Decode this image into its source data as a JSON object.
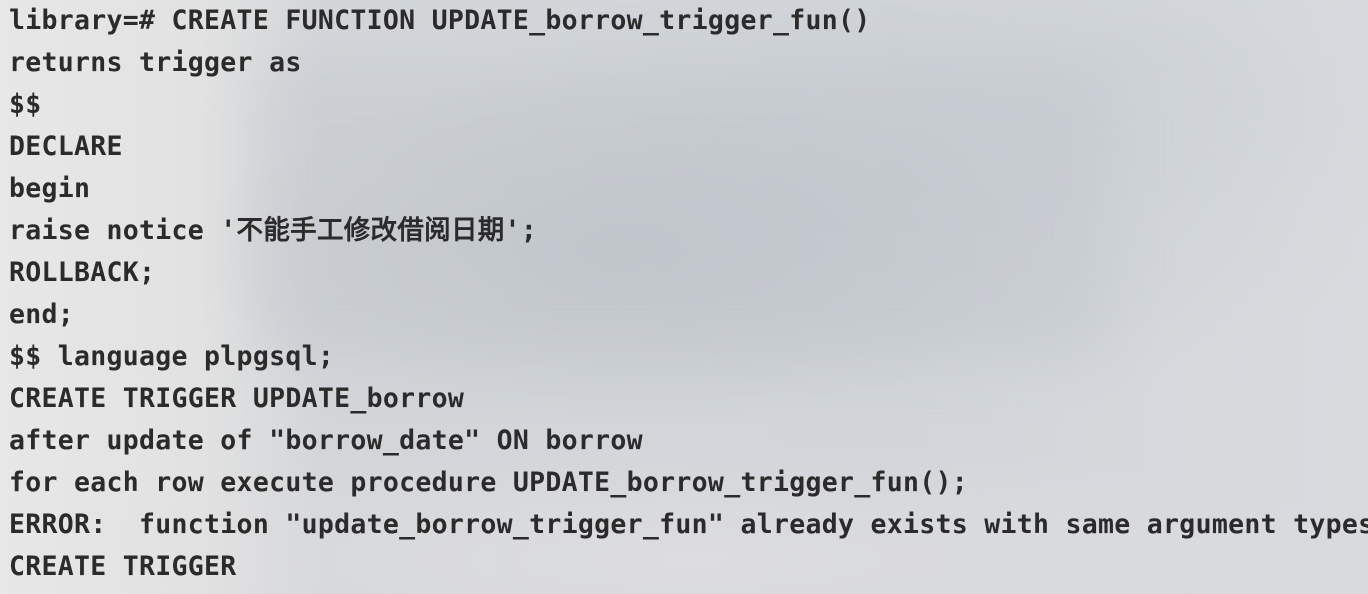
{
  "terminal": {
    "lines": [
      "library=# CREATE FUNCTION UPDATE_borrow_trigger_fun()",
      "returns trigger as",
      "$$",
      "DECLARE",
      "begin",
      "raise notice '不能手工修改借阅日期';",
      "ROLLBACK;",
      "end;",
      "$$ language plpgsql;",
      "CREATE TRIGGER UPDATE_borrow",
      "after update of \"borrow_date\" ON borrow",
      "for each row execute procedure UPDATE_borrow_trigger_fun();",
      "ERROR:  function \"update_borrow_trigger_fun\" already exists with same argument types",
      "CREATE TRIGGER"
    ]
  },
  "colors": {
    "text": "#2b2b2b",
    "background": "#d4d7da"
  }
}
